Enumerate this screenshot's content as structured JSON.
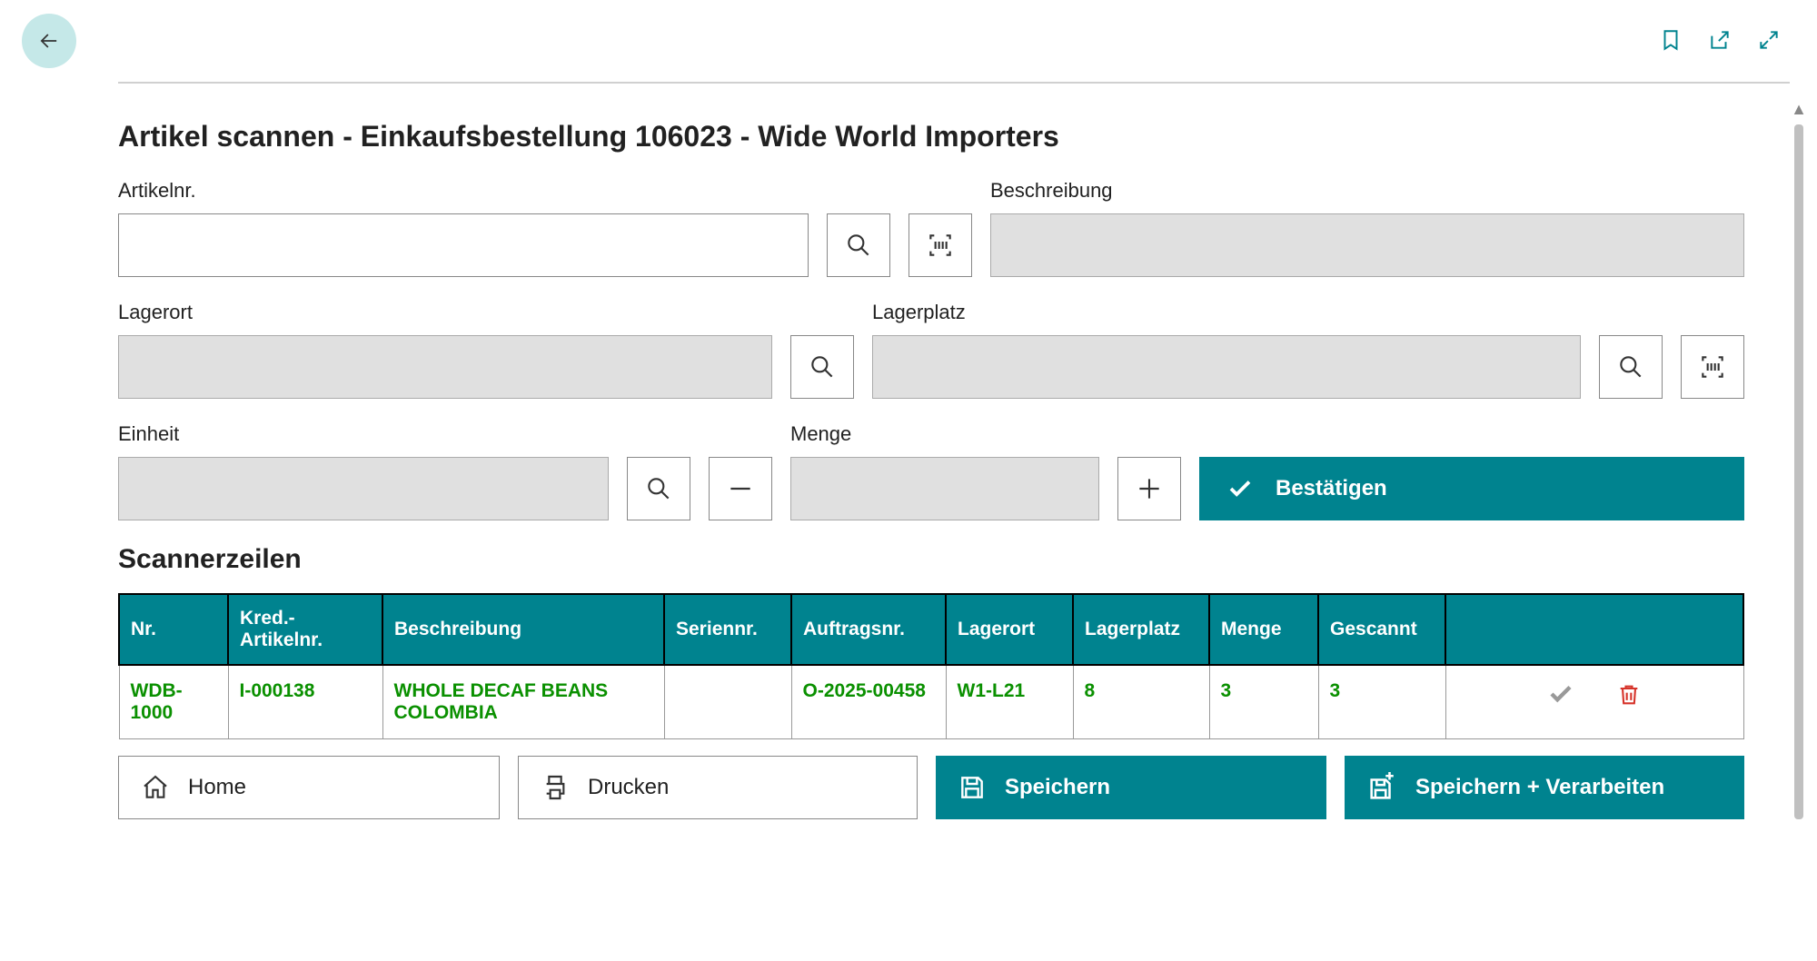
{
  "page": {
    "title": "Artikel scannen - Einkaufsbestellung 106023 - Wide World Importers"
  },
  "labels": {
    "artikelnr": "Artikelnr.",
    "beschreibung": "Beschreibung",
    "lagerort": "Lagerort",
    "lagerplatz": "Lagerplatz",
    "einheit": "Einheit",
    "menge": "Menge",
    "bestaetigen": "Bestätigen",
    "scannerzeilen": "Scannerzeilen"
  },
  "fields": {
    "artikelnr": "",
    "beschreibung": "",
    "lagerort": "",
    "lagerplatz": "",
    "einheit": "",
    "menge": ""
  },
  "table": {
    "headers": {
      "nr": "Nr.",
      "kred": "Kred.-Artikelnr.",
      "beschreibung": "Beschreibung",
      "seriennr": "Seriennr.",
      "auftragsnr": "Auftragsnr.",
      "lagerort": "Lagerort",
      "lagerplatz": "Lagerplatz",
      "menge": "Menge",
      "gescannt": "Gescannt"
    },
    "rows": [
      {
        "nr": "WDB-1000",
        "kred": "I-000138",
        "beschreibung": "WHOLE DECAF BEANS COLOMBIA",
        "seriennr": "",
        "auftragsnr": "O-2025-00458",
        "lagerort": "W1-L21",
        "lagerplatz": "8",
        "menge": "3",
        "gescannt": "3"
      }
    ]
  },
  "buttons": {
    "home": "Home",
    "drucken": "Drucken",
    "speichern": "Speichern",
    "speichern_verarbeiten": "Speichern + Verarbeiten"
  }
}
